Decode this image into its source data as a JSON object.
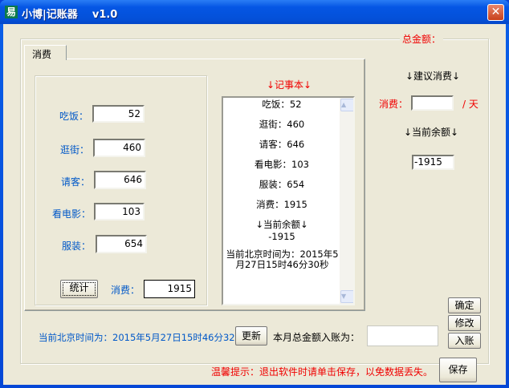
{
  "window": {
    "title": "小博|记账器    v1.0",
    "app_icon": "易",
    "close_icon": "✕"
  },
  "total_group_label": "总金额：",
  "tab": {
    "label": "消费"
  },
  "expenses": [
    {
      "label": "吃饭：",
      "value": "52"
    },
    {
      "label": "逛街：",
      "value": "460"
    },
    {
      "label": "请客：",
      "value": "646"
    },
    {
      "label": "看电影：",
      "value": "103"
    },
    {
      "label": "服装：",
      "value": "654"
    }
  ],
  "stat_button": "统计",
  "consume_label": "消费：",
  "consume_value": "1915",
  "notebook": {
    "title": "↓记事本↓",
    "lines": [
      "吃饭：52",
      "逛街：460",
      "请客：646",
      "看电影：103",
      "服装：654",
      "消费：1915"
    ],
    "balance_title": "↓当前余额↓",
    "balance": "-1915",
    "time_text": "当前北京时间为：2015年5月27日15时46分30秒"
  },
  "right": {
    "suggest_title": "↓建议消费↓",
    "consume_label": "消费：",
    "consume_value": "",
    "per_day": "/ 天",
    "balance_title": "↓当前余额↓",
    "balance_value": "-1915"
  },
  "buttons": {
    "confirm": "确定",
    "modify": "修改",
    "deposit": "入账",
    "refresh": "更新",
    "save": "保存"
  },
  "time_label": "当前北京时间为：2015年5月27日15时46分32秒",
  "month_deposit_label": "本月总金额入账为：",
  "month_deposit_value": "",
  "tip": "温馨提示：退出软件时请单击保存，以免数据丢失。"
}
